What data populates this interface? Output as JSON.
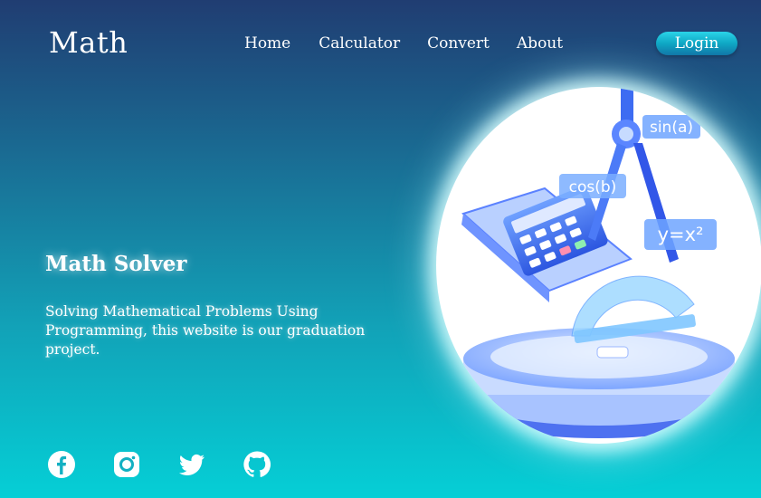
{
  "header": {
    "logo": "Math",
    "nav": [
      {
        "label": "Home"
      },
      {
        "label": "Calculator"
      },
      {
        "label": "Convert"
      },
      {
        "label": "About"
      }
    ],
    "login_label": "Login"
  },
  "hero": {
    "title": "Math Solver",
    "description": "Solving Mathematical Problems Using Programming, this website is our graduation project."
  },
  "illustration": {
    "labels": [
      "sin(a)",
      "cos(b)",
      "y=x²"
    ]
  },
  "socials": [
    {
      "icon": "facebook-icon"
    },
    {
      "icon": "instagram-icon"
    },
    {
      "icon": "twitter-icon"
    },
    {
      "icon": "github-icon"
    }
  ],
  "colors": {
    "bg_top": "#203d72",
    "bg_bottom": "#05cfd6",
    "login_button": "#0fa7c4",
    "illustration_accent": "#3b6cf0"
  }
}
